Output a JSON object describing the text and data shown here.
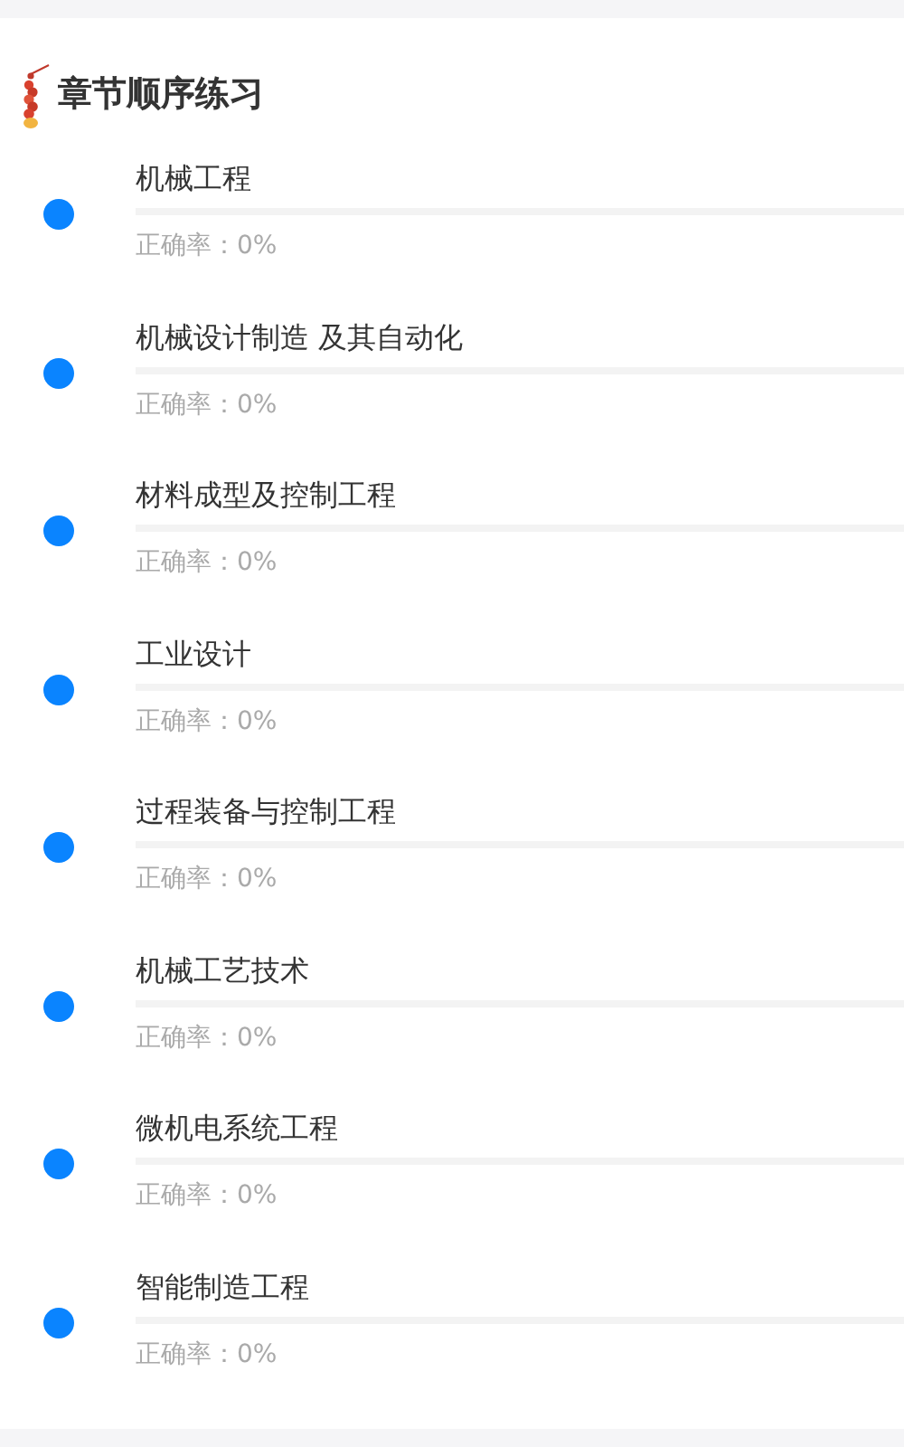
{
  "header": {
    "title": "章节顺序练习"
  },
  "chapters": [
    {
      "name": "机械工程",
      "accuracy": "正确率：0%"
    },
    {
      "name": "机械设计制造 及其自动化",
      "accuracy": "正确率：0%"
    },
    {
      "name": "材料成型及控制工程",
      "accuracy": "正确率：0%"
    },
    {
      "name": "工业设计",
      "accuracy": "正确率：0%"
    },
    {
      "name": "过程装备与控制工程",
      "accuracy": "正确率：0%"
    },
    {
      "name": "机械工艺技术",
      "accuracy": "正确率：0%"
    },
    {
      "name": "微机电系统工程",
      "accuracy": "正确率：0%"
    },
    {
      "name": "智能制造工程",
      "accuracy": "正确率：0%"
    }
  ]
}
